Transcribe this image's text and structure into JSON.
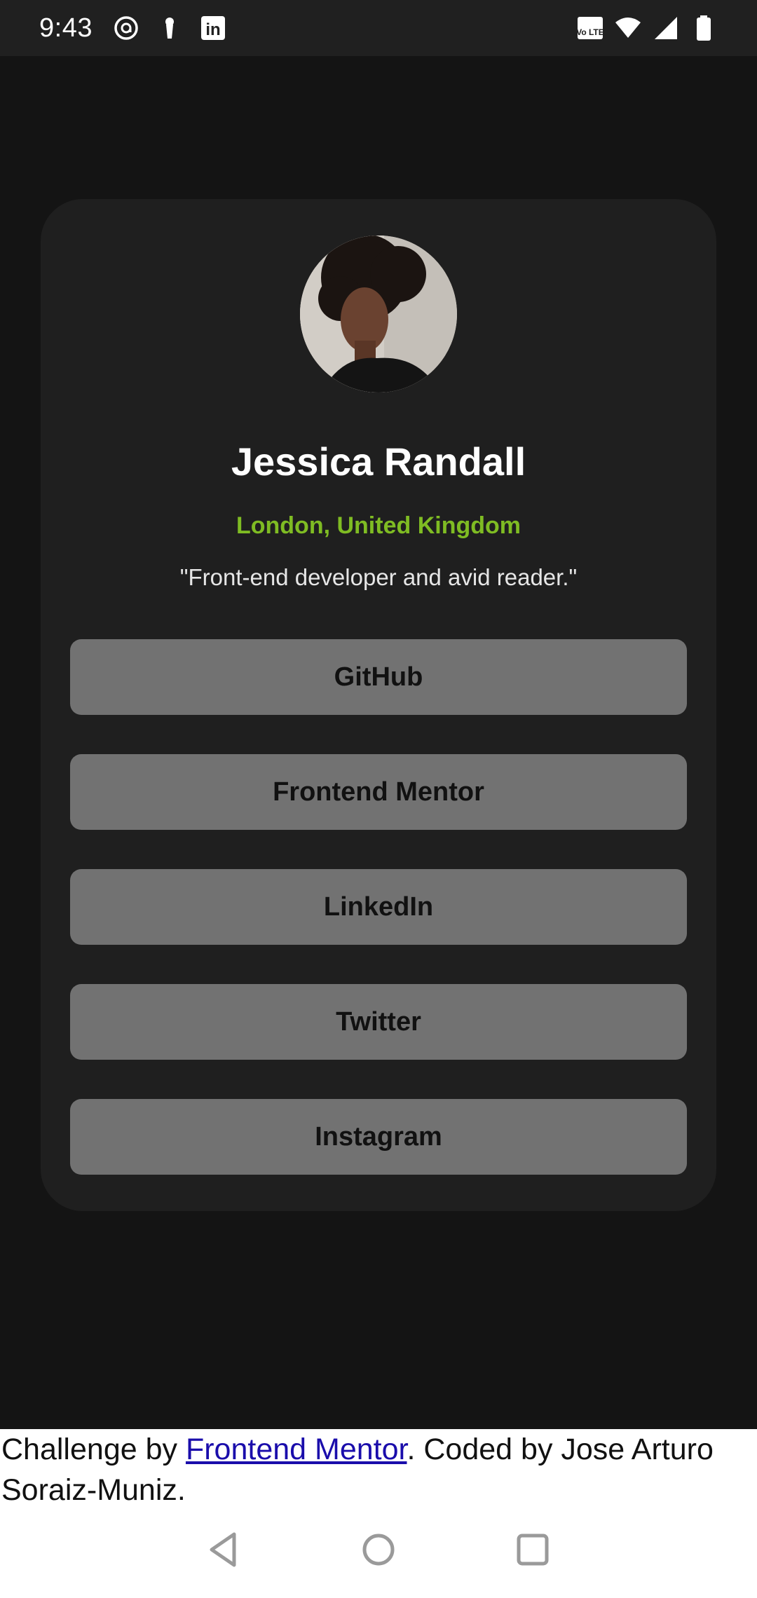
{
  "status_bar": {
    "time": "9:43",
    "left_icons": [
      "threads-icon",
      "keyhole-icon",
      "linkedin-icon"
    ],
    "right_icons": [
      "volte-icon",
      "wifi-icon",
      "signal-icon",
      "battery-icon"
    ],
    "volte_text": "Vo LTE",
    "linkedin_text": "in"
  },
  "profile": {
    "name": "Jessica Randall",
    "location": "London, United Kingdom",
    "bio": "\"Front-end developer and avid reader.\""
  },
  "links": [
    {
      "label": "GitHub"
    },
    {
      "label": "Frontend Mentor"
    },
    {
      "label": "LinkedIn"
    },
    {
      "label": "Twitter"
    },
    {
      "label": "Instagram"
    }
  ],
  "attribution": {
    "prefix": "Challenge by ",
    "link_text": "Frontend Mentor",
    "suffix": ". Coded by Jose Arturo Soraiz-Muniz."
  },
  "nav": {
    "icons": [
      "back-icon",
      "home-icon",
      "recents-icon"
    ]
  },
  "colors": {
    "background": "#141414",
    "card": "#1f1f1f",
    "accent_green": "#7fbc23",
    "button": "#727272"
  }
}
